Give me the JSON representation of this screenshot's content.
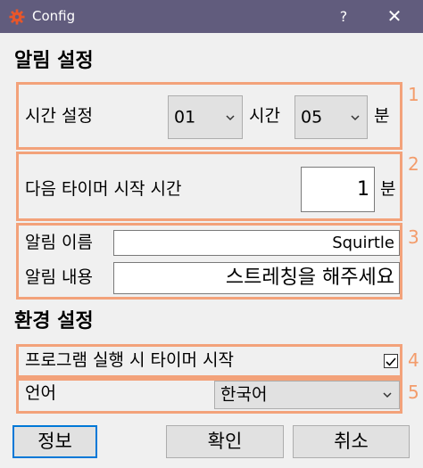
{
  "window": {
    "title": "Config",
    "icon": "gear-icon",
    "help_label": "?",
    "close_label": "✕",
    "title_bar_color": "#615c7d"
  },
  "alarm_section": {
    "title": "알림 설정",
    "time_setting": {
      "marker": "1",
      "label": "시간 설정",
      "hour_value": "01",
      "hour_label": "시간",
      "minute_value": "05",
      "minute_label": "분"
    },
    "timer_start": {
      "marker": "2",
      "label": "다음 타이머 시작 시간",
      "value": "1",
      "unit": "분"
    },
    "alarm_info": {
      "marker": "3",
      "name_label": "알림 이름",
      "name_value": "Squirtle",
      "content_label": "알림 내용",
      "content_value": "스트레칭을 해주세요"
    }
  },
  "env_section": {
    "title": "환경 설정",
    "startup": {
      "marker": "4",
      "label": "프로그램 실행 시 타이머 시작",
      "checked": true
    },
    "language": {
      "marker": "5",
      "label": "언어",
      "value": "한국어"
    }
  },
  "buttons": {
    "info": "정보",
    "ok": "확인",
    "cancel": "취소"
  },
  "colors": {
    "highlight_border": "#f3a27a",
    "marker": "#f39c6b",
    "default_button_border": "#0078d7"
  }
}
